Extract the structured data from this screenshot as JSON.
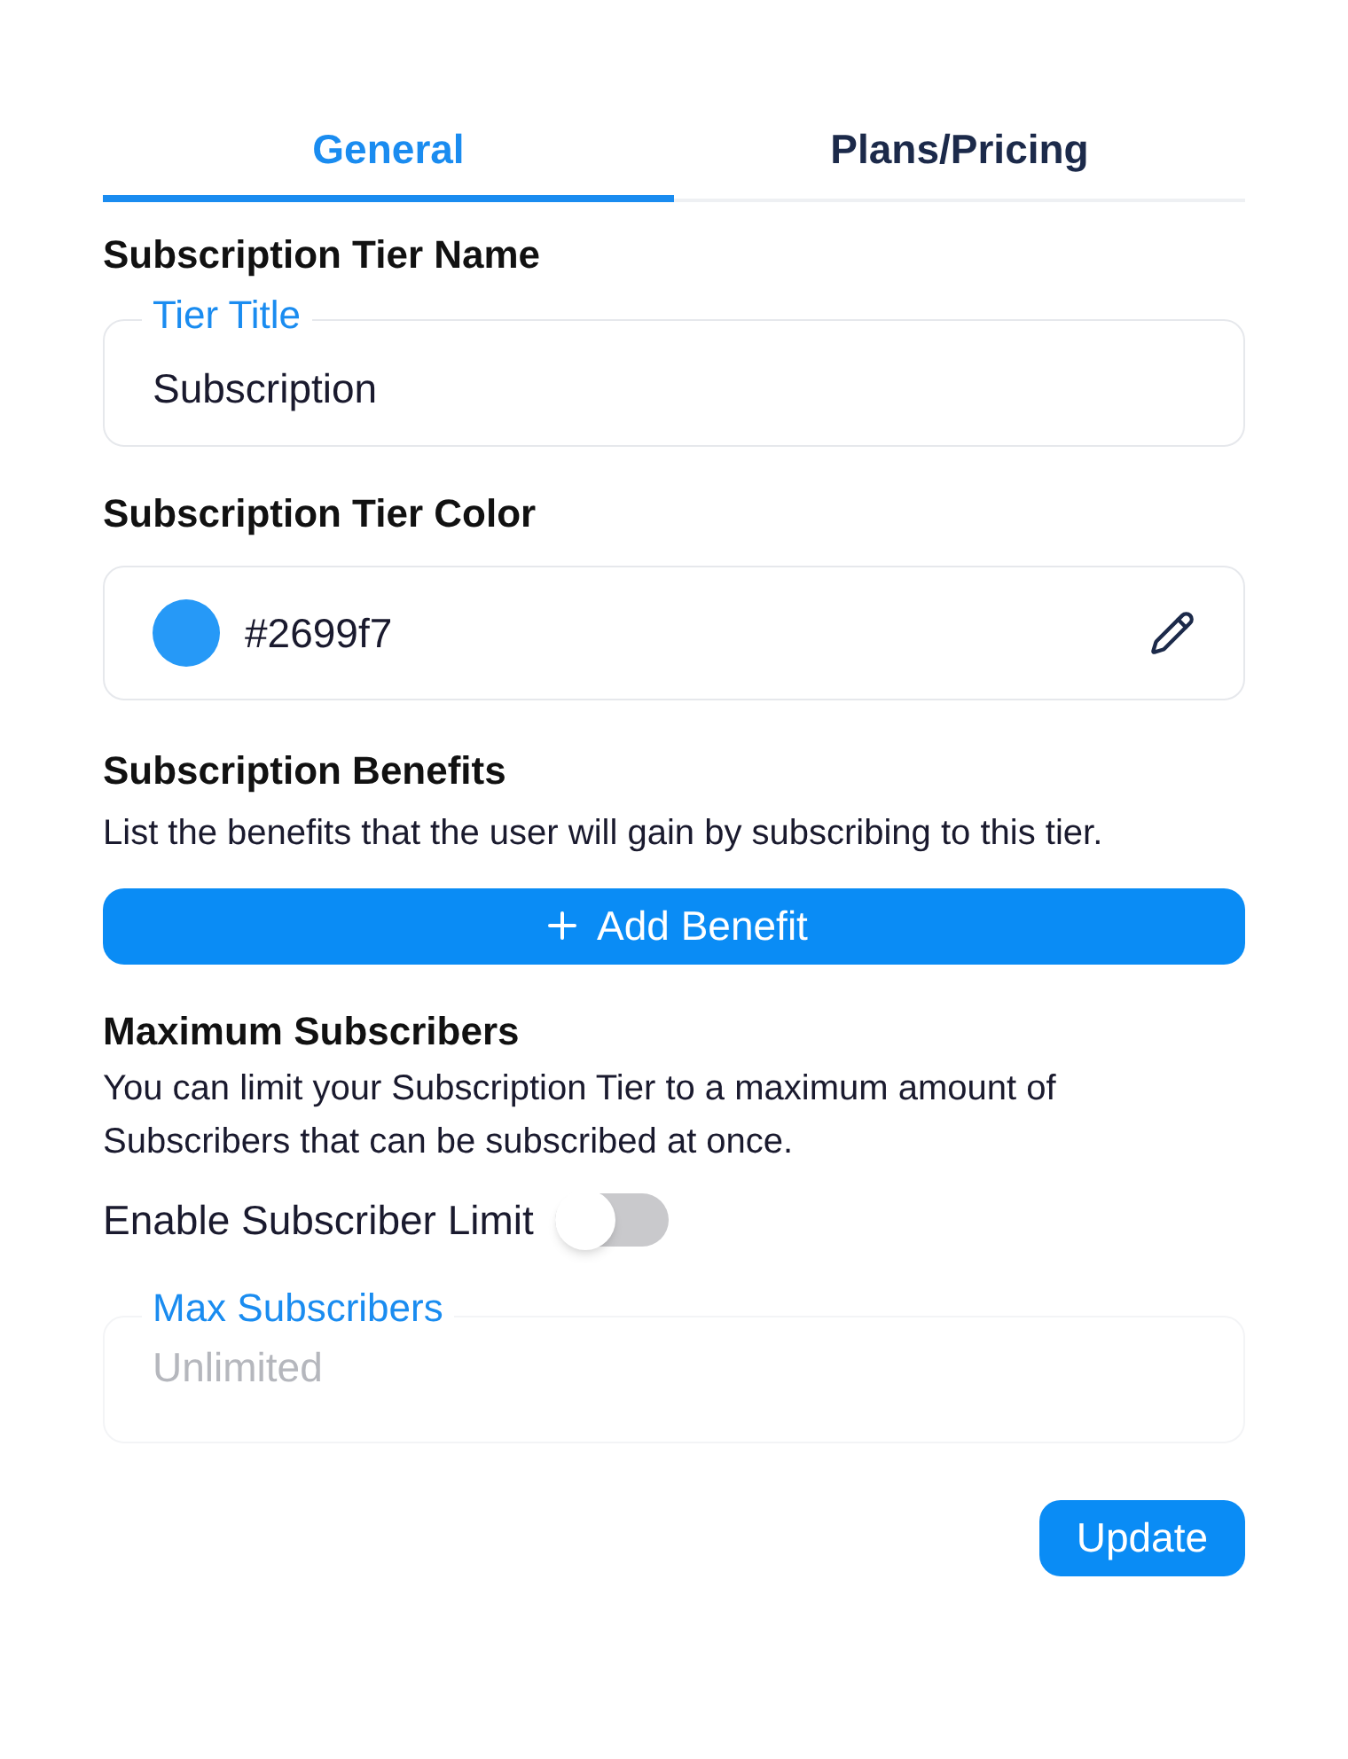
{
  "tabs": [
    {
      "label": "General",
      "selected": true
    },
    {
      "label": "Plans/Pricing",
      "selected": false
    }
  ],
  "tier_name": {
    "heading": "Subscription Tier Name",
    "field": {
      "label": "Tier Title",
      "value": "Subscription"
    }
  },
  "tier_color": {
    "heading": "Subscription Tier Color",
    "value": "#2699f7",
    "color": "#2699f7"
  },
  "benefits": {
    "heading": "Subscription Benefits",
    "description": "List the benefits that the user will gain by subscribing to this tier.",
    "button": "Add Benefit"
  },
  "max_subscribers": {
    "heading": "Maximum Subscribers",
    "description": "You can limit your Subscription Tier to a maximum amount of Subscribers that can be subscribed at once.",
    "toggle": {
      "label": "Enable Subscriber Limit",
      "on": false
    },
    "field": {
      "label": "Max Subscribers",
      "placeholder": "Unlimited",
      "disabled": true
    }
  },
  "update_button": "Update"
}
